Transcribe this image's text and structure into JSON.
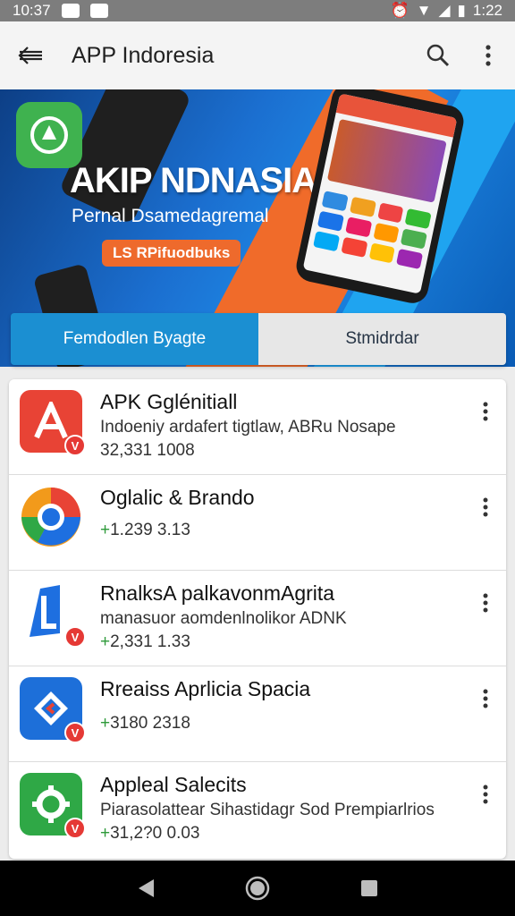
{
  "status_bar": {
    "time_left": "10:37",
    "time_right": "1:22"
  },
  "app_bar": {
    "title": "APP Indoresia"
  },
  "banner": {
    "headline": "AKIP NDNASIA",
    "tagline": "Pernal Dsamedagremal",
    "cta": "LS RPifuodbuks"
  },
  "tabs": [
    {
      "label": "Femdodlen Byagte",
      "active": true
    },
    {
      "label": "Stmidrdar",
      "active": false
    }
  ],
  "apps": [
    {
      "title": "APK Gglénitiall",
      "description": "Indoeniy ardafert tigtlaw, ABRu Nosape",
      "meta_prefix": "",
      "meta": "32,331 1008",
      "color": "#e84335",
      "badge": "V"
    },
    {
      "title": "Oglalic & Brando",
      "description": "",
      "meta_prefix": "+",
      "meta": "1.239 3.13",
      "color": "#f29a1b",
      "badge": ""
    },
    {
      "title": "RnalksA palkavonmAgrita",
      "description": "manasuor aomdenlnolikor ADNK",
      "meta_prefix": "+",
      "meta": "2,331 1.33",
      "color": "#1e6fe0",
      "badge": "V"
    },
    {
      "title": "Rreaiss Aprlicia Spacia",
      "description": "",
      "meta_prefix": "+",
      "meta": "3180 2318",
      "color": "#1d6fd9",
      "badge": "V"
    },
    {
      "title": "Appleal Salecits",
      "description": "Piarasolattear Sihastidagr Sod Prempiarlrios",
      "meta_prefix": "+",
      "meta": "31,2?0 0.03",
      "color": "#2fa846",
      "badge": "V"
    }
  ],
  "icons": {
    "back": "arrow-left-icon",
    "search": "search-icon",
    "more": "more-vert-icon",
    "nav_back": "triangle-back-icon",
    "nav_home": "circle-home-icon",
    "nav_recent": "square-recents-icon"
  }
}
